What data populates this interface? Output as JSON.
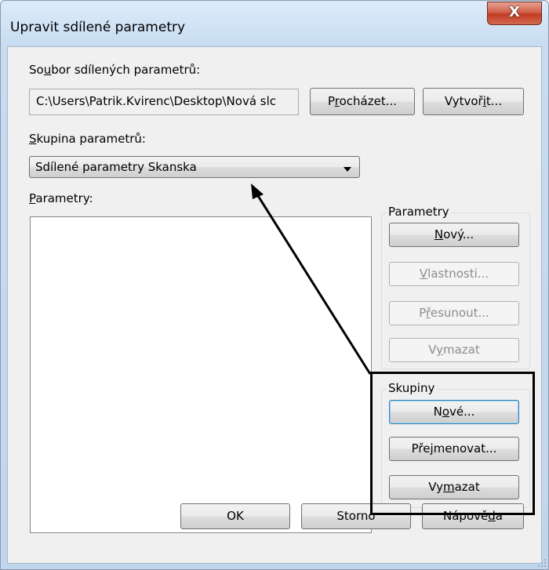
{
  "window": {
    "title": "Upravit sdílené parametry",
    "close_glyph": "X"
  },
  "shared_file": {
    "label_pre": "So",
    "label_u": "u",
    "label_post": "bor sdílených parametrů:",
    "path": "C:\\Users\\Patrik.Kvirenc\\Desktop\\Nová slc",
    "browse_pre": "P",
    "browse_u": "r",
    "browse_post": "ocházet...",
    "create_pre": "Vytvoř",
    "create_u": "i",
    "create_post": "t..."
  },
  "group": {
    "label_u": "S",
    "label_post": "kupina parametrů:",
    "selected": "Sdílené parametry Skanska"
  },
  "params_list": {
    "label_u": "P",
    "label_post": "arametry:"
  },
  "params_box": {
    "legend": "Parametry",
    "new_u": "N",
    "new_post": "ový...",
    "props_u": "V",
    "props_post": "lastnosti...",
    "move_pre": "P",
    "move_u": "ř",
    "move_post": "esunout...",
    "delete_pre": "V",
    "delete_u": "y",
    "delete_post": "mazat"
  },
  "groups_box": {
    "legend": "Skupiny",
    "new_pre": "N",
    "new_u": "o",
    "new_post": "vé...",
    "rename_pre": "Pře",
    "rename_u": "j",
    "rename_post": "menovat...",
    "delete_pre": "Vy",
    "delete_u": "m",
    "delete_post": "azat"
  },
  "footer": {
    "ok": "OK",
    "cancel": "Storno",
    "help_pre": "Nápově",
    "help_u": "d",
    "help_post": "a"
  }
}
